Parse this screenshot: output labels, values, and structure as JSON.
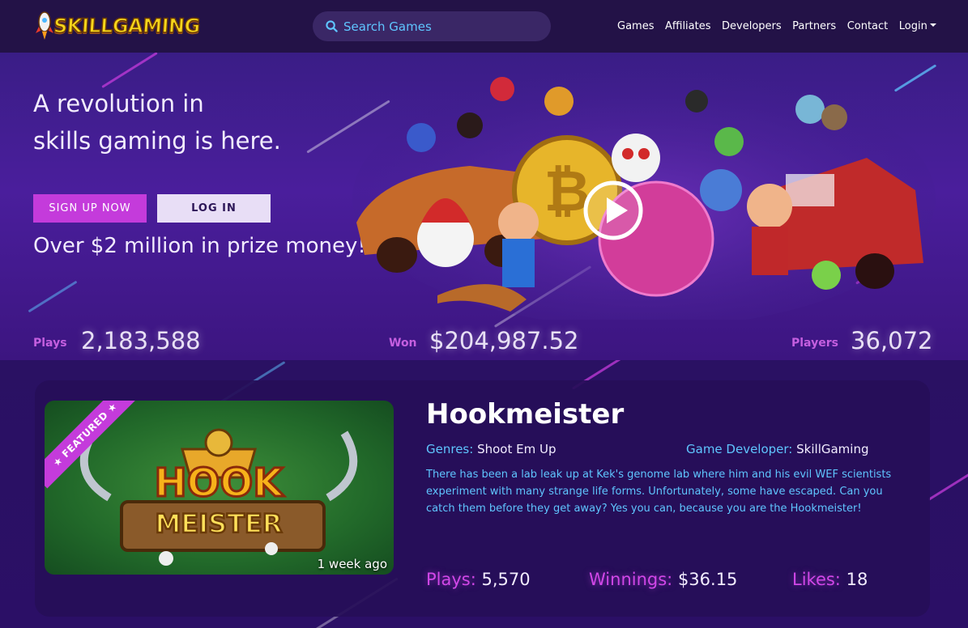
{
  "navbar": {
    "logo_text": "SKILLGAMING",
    "search_placeholder": "Search Games",
    "links": [
      "Games",
      "Affiliates",
      "Developers",
      "Partners",
      "Contact"
    ],
    "login_label": "Login"
  },
  "hero": {
    "title_line1": "A revolution in",
    "title_line2": "skills gaming is here.",
    "signup_label": "SIGN UP NOW",
    "login_label": "LOG IN",
    "prize_text": "Over $2 million in prize money!",
    "stats": {
      "plays_label": "Plays",
      "plays_value": "2,183,588",
      "won_label": "Won",
      "won_value": "$204,987.52",
      "players_label": "Players",
      "players_value": "36,072"
    }
  },
  "featured": {
    "ribbon": "★ FEATURED ★",
    "time_ago": "1 week ago",
    "thumb_title_1": "HOOK",
    "thumb_title_2": "MEISTER",
    "title": "Hookmeister",
    "genres_label": "Genres:",
    "genres_value": "Shoot Em Up",
    "developer_label": "Game Developer:",
    "developer_value": "SkillGaming",
    "description": "There has been a lab leak up at Kek's genome lab where him and his evil WEF scientists experiment with many strange life forms. Unfortunately, some have escaped. Can you catch them before they get away? Yes you can, because you are the Hookmeister!",
    "plays_label": "Plays:",
    "plays_value": "5,570",
    "winnings_label": "Winnings:",
    "winnings_value": "$36.15",
    "likes_label": "Likes:",
    "likes_value": "18"
  },
  "colors": {
    "accent_pink": "#c43bdb",
    "accent_blue": "#5fc5ff",
    "navbar_bg": "#231247",
    "logo_yellow": "#f7d61a"
  }
}
